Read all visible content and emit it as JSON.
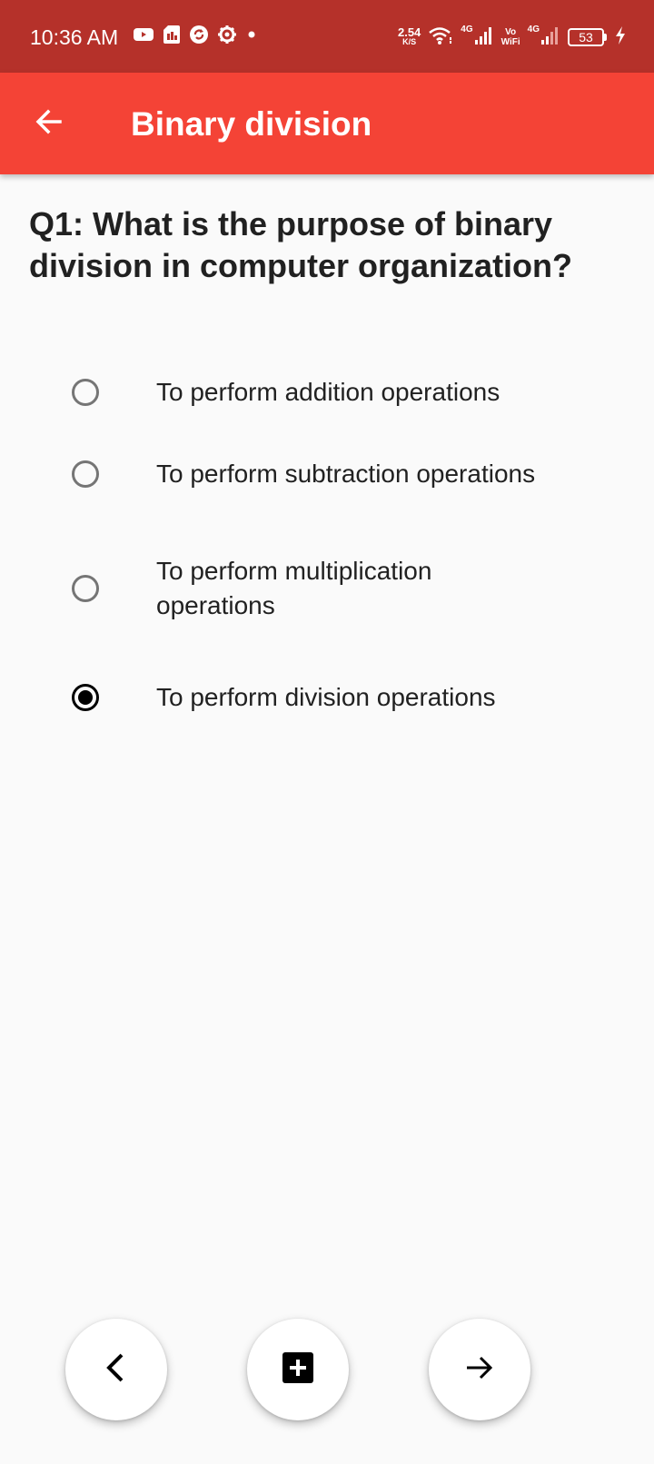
{
  "status_bar": {
    "time": "10:36 AM",
    "net_speed_value": "2.54",
    "net_speed_unit": "K/S",
    "signal1_label": "4G",
    "vowifi_top": "Vo",
    "vowifi_bottom": "WiFi",
    "signal2_label": "4G",
    "battery_level": "53",
    "icons": [
      "youtube-icon",
      "sim-icon",
      "sync-icon",
      "settings-icon",
      "dot-icon",
      "wifi-icon",
      "signal-icon",
      "battery-icon",
      "charging-icon"
    ]
  },
  "app_bar": {
    "title": "Binary division",
    "background": "#f44336",
    "status_background": "#b5312a"
  },
  "question": {
    "text": "Q1: What is the purpose of binary division in computer organization?"
  },
  "options": [
    {
      "label": "To perform addition operations",
      "selected": false
    },
    {
      "label": "To perform subtraction operations",
      "selected": false
    },
    {
      "label": "To perform multiplication operations",
      "selected": false
    },
    {
      "label": "To perform division operations",
      "selected": true
    }
  ],
  "bottom_nav": {
    "buttons": [
      "chevron-left-icon",
      "add-box-icon",
      "arrow-right-icon"
    ]
  }
}
